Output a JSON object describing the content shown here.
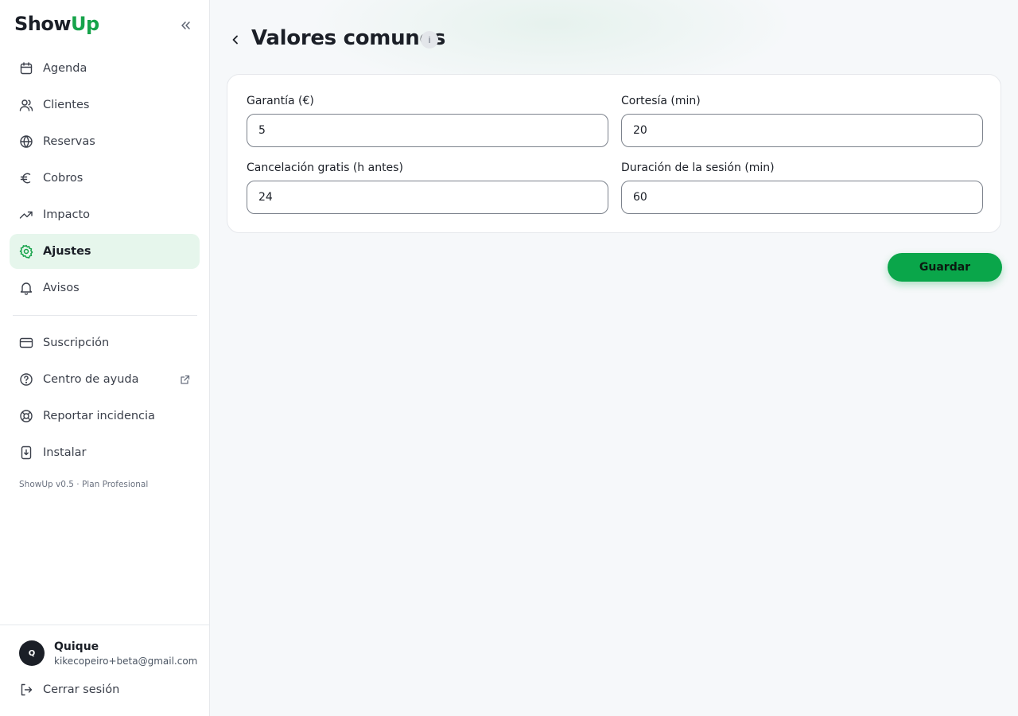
{
  "brand": {
    "name_part1": "Show",
    "name_part2": "Up",
    "accent_color": "#16a34a"
  },
  "sidebar": {
    "collapse_icon": "chevrons-left-icon",
    "items": [
      {
        "label": "Agenda",
        "icon": "calendar-icon"
      },
      {
        "label": "Clientes",
        "icon": "users-icon"
      },
      {
        "label": "Reservas",
        "icon": "globe-icon"
      },
      {
        "label": "Cobros",
        "icon": "euro-icon"
      },
      {
        "label": "Impacto",
        "icon": "trending-up-icon"
      },
      {
        "label": "Ajustes",
        "icon": "gear-icon",
        "active": true
      },
      {
        "label": "Avisos",
        "icon": "bell-icon"
      }
    ],
    "secondary_items": [
      {
        "label": "Suscripción",
        "icon": "credit-card-icon"
      },
      {
        "label": "Centro de ayuda",
        "icon": "help-circle-icon",
        "external": true
      },
      {
        "label": "Reportar incidencia",
        "icon": "lifebuoy-icon"
      },
      {
        "label": "Instalar",
        "icon": "install-icon"
      }
    ],
    "version": "ShowUp v0.5 · Plan Profesional",
    "user": {
      "initial": "Q",
      "name": "Quique",
      "email": "kikecopeiro+beta@gmail.com"
    },
    "logout_label": "Cerrar sesión"
  },
  "main": {
    "title": "Valores comunes",
    "info_icon_text": "i",
    "fields": [
      {
        "label": "Garantía (€)",
        "value": "5"
      },
      {
        "label": "Cortesía (min)",
        "value": "20"
      },
      {
        "label": "Cancelación gratis (h antes)",
        "value": "24"
      },
      {
        "label": "Duración de la sesión (min)",
        "value": "60"
      }
    ],
    "save_label": "Guardar"
  }
}
